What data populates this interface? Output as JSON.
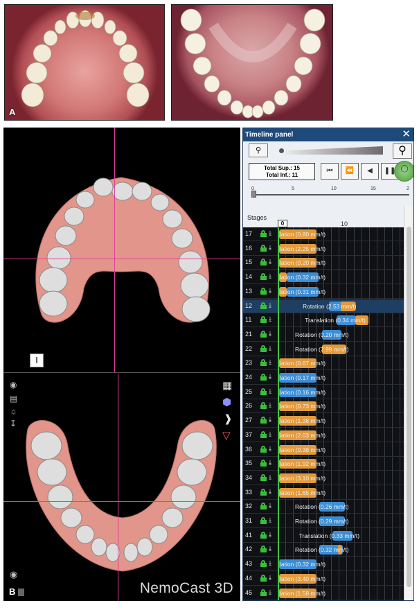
{
  "photos": {
    "upper_label": "A",
    "lower_label": ""
  },
  "viewport": {
    "stage_marker": "I",
    "view_b_label": "B",
    "brand": "NemoCast 3D",
    "left_icons": [
      "camera-icon",
      "image-icon",
      "globe-icon",
      "export-icon"
    ],
    "right_icons": [
      "grid-cube-icon",
      "mesh-icon",
      "profile-icon",
      "teeth-icon"
    ]
  },
  "panel": {
    "title": "Timeline panel",
    "close": "✕",
    "totals": {
      "sup": "Total Sup.: 15",
      "inf": "Total Inf.: 11"
    },
    "step_labels": [
      "0",
      "5",
      "10",
      "15",
      "2"
    ],
    "stages_label": "Stages",
    "stage_cursor": "0",
    "stage_ten": "10"
  },
  "rows": [
    {
      "id": "17",
      "text": "lation (0.80 mm/t)",
      "bars": [
        {
          "c": "o",
          "s": 0,
          "w": 4.9
        }
      ],
      "textStart": 0
    },
    {
      "id": "16",
      "text": "lation (2.25 mm/t)",
      "bars": [
        {
          "c": "o",
          "s": 0,
          "w": 4.9
        }
      ],
      "textStart": 0
    },
    {
      "id": "15",
      "text": "lation (0.20 mm/t)",
      "bars": [
        {
          "c": "o",
          "s": 0,
          "w": 4.9
        }
      ],
      "textStart": 0
    },
    {
      "id": "14",
      "text": "lation (0.32 mm/t)",
      "bars": [
        {
          "c": "o",
          "s": 0,
          "w": 1
        },
        {
          "c": "b",
          "s": 1,
          "w": 4.2
        }
      ],
      "textStart": 0
    },
    {
      "id": "13",
      "text": "lation (0.31 mm/t)",
      "bars": [
        {
          "c": "o",
          "s": 0,
          "w": 1
        },
        {
          "c": "b",
          "s": 1,
          "w": 4.2
        }
      ],
      "textStart": 0
    },
    {
      "id": "12",
      "text": "Rotation (2.53 mm/t)",
      "bars": [
        {
          "c": "b",
          "s": 6.5,
          "w": 3.6
        },
        {
          "c": "o",
          "s": 8.1,
          "w": 1.9
        }
      ],
      "textStart": 3.0,
      "sel": true
    },
    {
      "id": "11",
      "text": "Translation (0.34 mm/t)",
      "bars": [
        {
          "c": "b",
          "s": 7.5,
          "w": 2.6
        },
        {
          "c": "o",
          "s": 10.0,
          "w": 1.7
        }
      ],
      "textStart": 3.3
    },
    {
      "id": "21",
      "text": "Rotation (0.20 mm/t)",
      "bars": [
        {
          "c": "b",
          "s": 5.6,
          "w": 2.6
        }
      ],
      "textStart": 2.0
    },
    {
      "id": "22",
      "text": "Rotation (2.99 mm/t)",
      "bars": [
        {
          "c": "o",
          "s": 5.6,
          "w": 3.2
        }
      ],
      "textStart": 2.0
    },
    {
      "id": "23",
      "text": "lation (0.67 mm/t)",
      "bars": [
        {
          "c": "o",
          "s": 0,
          "w": 4.9
        }
      ],
      "textStart": 0
    },
    {
      "id": "24",
      "text": "lation (0.17 mm/t)",
      "bars": [
        {
          "c": "b",
          "s": 0,
          "w": 4.9
        }
      ],
      "textStart": 0
    },
    {
      "id": "25",
      "text": "lation (0.16 mm/t)",
      "bars": [
        {
          "c": "b",
          "s": 0,
          "w": 4.9
        }
      ],
      "textStart": 0
    },
    {
      "id": "26",
      "text": "lation (0.73 mm/t)",
      "bars": [
        {
          "c": "o",
          "s": 0,
          "w": 4.9
        }
      ],
      "textStart": 0
    },
    {
      "id": "27",
      "text": "lation (1.38 mm/t)",
      "bars": [
        {
          "c": "o",
          "s": 0,
          "w": 4.9
        }
      ],
      "textStart": 0
    },
    {
      "id": "37",
      "text": "lation (2.03 mm/t)",
      "bars": [
        {
          "c": "o",
          "s": 0,
          "w": 4.9
        }
      ],
      "textStart": 0
    },
    {
      "id": "36",
      "text": "lation (0.38 mm/t)",
      "bars": [
        {
          "c": "o",
          "s": 0,
          "w": 4.9
        }
      ],
      "textStart": 0
    },
    {
      "id": "35",
      "text": "lation (1.92 mm/t)",
      "bars": [
        {
          "c": "o",
          "s": 0,
          "w": 4.9
        }
      ],
      "textStart": 0
    },
    {
      "id": "34",
      "text": "lation (3.10 mm/t)",
      "bars": [
        {
          "c": "o",
          "s": 0,
          "w": 4.9
        }
      ],
      "textStart": 0
    },
    {
      "id": "33",
      "text": "lation (1.65 mm/t)",
      "bars": [
        {
          "c": "o",
          "s": 0,
          "w": 4.9
        }
      ],
      "textStart": 0
    },
    {
      "id": "32",
      "text": "Rotation (0.26 mm/t)",
      "bars": [
        {
          "c": "b",
          "s": 5.3,
          "w": 3.3
        }
      ],
      "textStart": 2.0
    },
    {
      "id": "31",
      "text": "Rotation (0.29 mm/t)",
      "bars": [
        {
          "c": "b",
          "s": 5.3,
          "w": 3.3
        }
      ],
      "textStart": 2.0
    },
    {
      "id": "41",
      "text": "Translation (0.33 mm/t)",
      "bars": [
        {
          "c": "b",
          "s": 7.0,
          "w": 2.6
        }
      ],
      "textStart": 2.5
    },
    {
      "id": "42",
      "text": "Rotation (0.32 mm/t)",
      "bars": [
        {
          "c": "b",
          "s": 5.3,
          "w": 3.1
        },
        {
          "c": "o",
          "s": 7.7,
          "w": 0.6
        }
      ],
      "textStart": 2.0
    },
    {
      "id": "43",
      "text": "lation (0.32 mm/t)",
      "bars": [
        {
          "c": "b",
          "s": 0,
          "w": 4.9
        }
      ],
      "textStart": 0
    },
    {
      "id": "44",
      "text": "lation (3.40 mm/t)",
      "bars": [
        {
          "c": "o",
          "s": 0,
          "w": 4.9
        }
      ],
      "textStart": 0
    },
    {
      "id": "45",
      "text": "lation (1.58 mm/t)",
      "bars": [
        {
          "c": "o",
          "s": 0,
          "w": 4.9
        }
      ],
      "textStart": 0
    }
  ]
}
